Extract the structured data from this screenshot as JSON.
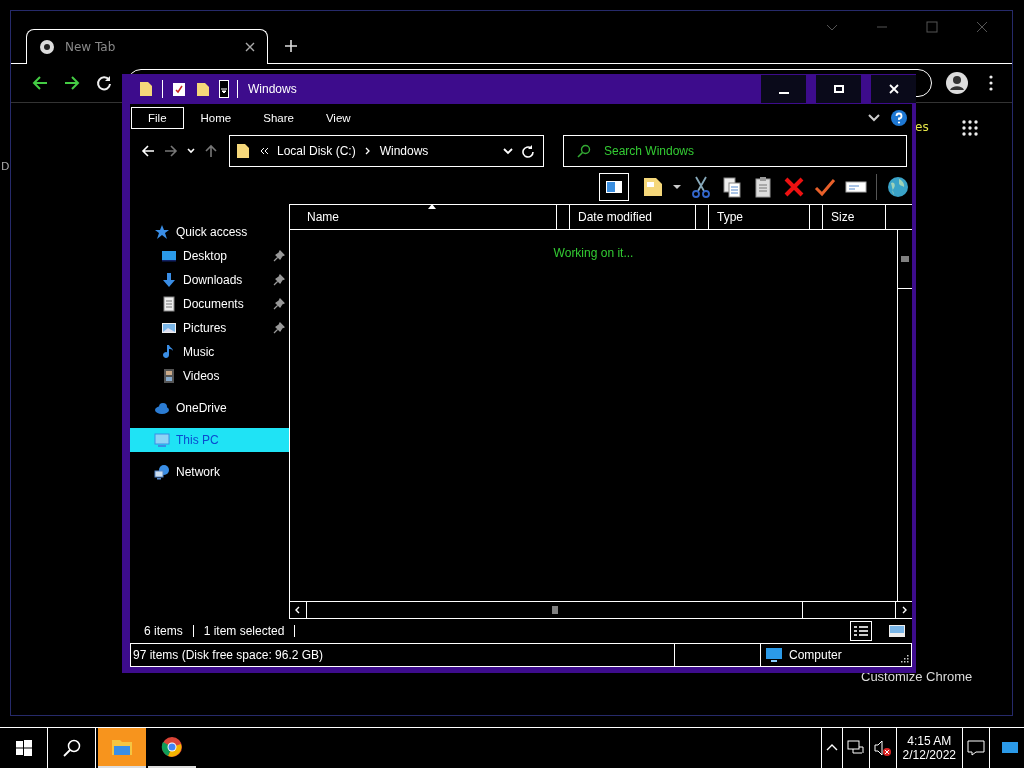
{
  "browser": {
    "tab": {
      "title": "New Tab",
      "selected": true
    },
    "page_fragments": [
      "D",
      "es"
    ],
    "customize_button": "Customize Chrome"
  },
  "explorer": {
    "title": "Windows",
    "ribbon_tabs": [
      {
        "label": "File",
        "selected": true
      },
      {
        "label": "Home",
        "selected": false
      },
      {
        "label": "Share",
        "selected": false
      },
      {
        "label": "View",
        "selected": false
      }
    ],
    "breadcrumb": [
      "Local Disk (C:)",
      "Windows"
    ],
    "search": {
      "placeholder": "Search Windows"
    },
    "columns": [
      "Name",
      "Date modified",
      "Type",
      "Size"
    ],
    "loading_message": "Working on it...",
    "nav": [
      {
        "label": "Quick access",
        "kind": "star",
        "selected": false,
        "children": [
          {
            "label": "Desktop",
            "kind": "desktop",
            "pinned": true,
            "selected": false
          },
          {
            "label": "Downloads",
            "kind": "download",
            "pinned": true,
            "selected": false
          },
          {
            "label": "Documents",
            "kind": "document",
            "pinned": true,
            "selected": false
          },
          {
            "label": "Pictures",
            "kind": "picture",
            "pinned": true,
            "selected": false
          },
          {
            "label": "Music",
            "kind": "music",
            "pinned": false,
            "selected": false
          },
          {
            "label": "Videos",
            "kind": "video",
            "pinned": false,
            "selected": false
          }
        ]
      },
      {
        "label": "OneDrive",
        "kind": "cloud",
        "selected": false
      },
      {
        "label": "This PC",
        "kind": "pc",
        "selected": true
      },
      {
        "label": "Network",
        "kind": "network",
        "selected": false
      }
    ],
    "status": [
      "6 items",
      "1 item selected"
    ],
    "details": {
      "summary": "97 items (Disk free space: 96.2 GB)",
      "location": "Computer"
    }
  },
  "taskbar": {
    "apps": [
      {
        "kind": "explorer",
        "active": true
      },
      {
        "kind": "chrome",
        "active": false
      }
    ],
    "time": "4:15 AM",
    "date": "2/12/2022"
  }
}
